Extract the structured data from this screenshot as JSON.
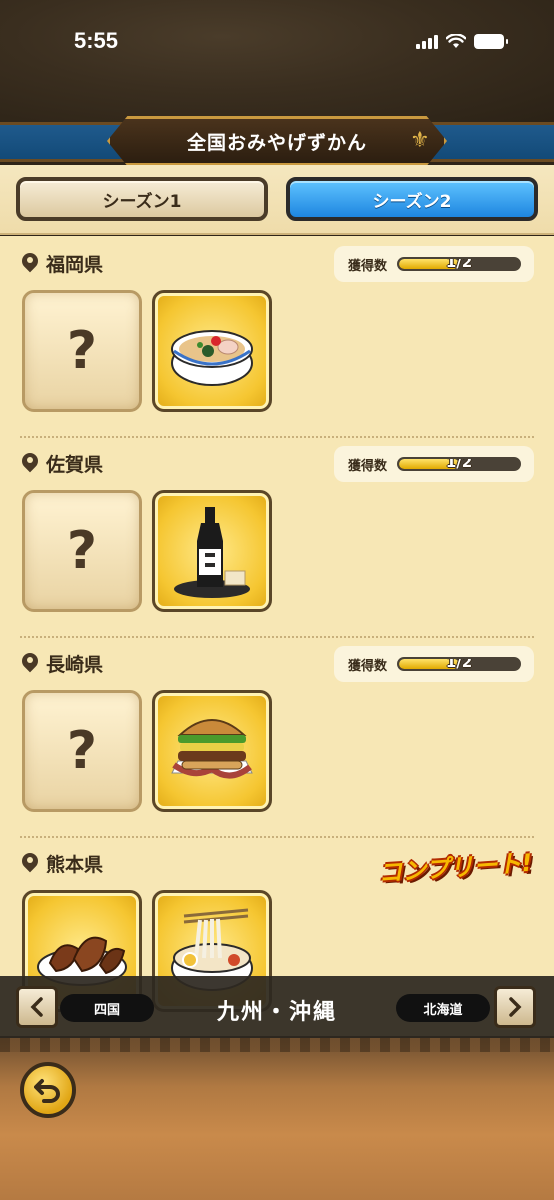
{
  "status_bar": {
    "time": "5:55"
  },
  "header": {
    "title": "全国おみやげずかん"
  },
  "tabs": [
    {
      "label": "シーズン1",
      "selected": false
    },
    {
      "label": "シーズン2",
      "selected": true
    }
  ],
  "sections": [
    {
      "prefecture": "福岡県",
      "count_label": "獲得数",
      "count_text": "1/2",
      "progress": 0.5,
      "items": [
        {
          "state": "unknown",
          "glyph": "?"
        },
        {
          "state": "owned",
          "icon": "ramen-icon"
        }
      ]
    },
    {
      "prefecture": "佐賀県",
      "count_label": "獲得数",
      "count_text": "1/2",
      "progress": 0.5,
      "items": [
        {
          "state": "unknown",
          "glyph": "?"
        },
        {
          "state": "owned",
          "icon": "sake-bottle-icon"
        }
      ]
    },
    {
      "prefecture": "長崎県",
      "count_label": "獲得数",
      "count_text": "1/2",
      "progress": 0.5,
      "items": [
        {
          "state": "unknown",
          "glyph": "?"
        },
        {
          "state": "owned",
          "icon": "burger-icon"
        }
      ]
    },
    {
      "prefecture": "熊本県",
      "complete_text": "コンプリート!",
      "items": [
        {
          "state": "owned",
          "icon": "baked-goods-icon"
        },
        {
          "state": "owned",
          "icon": "noodle-soup-icon"
        }
      ]
    }
  ],
  "region_nav": {
    "prev_label": "四国",
    "current": "九州・沖縄",
    "next_label": "北海道"
  },
  "colors": {
    "tab_active": "#1e86e0",
    "accent_gold": "#f5c631",
    "panel_bg": "#f7e7b5"
  }
}
